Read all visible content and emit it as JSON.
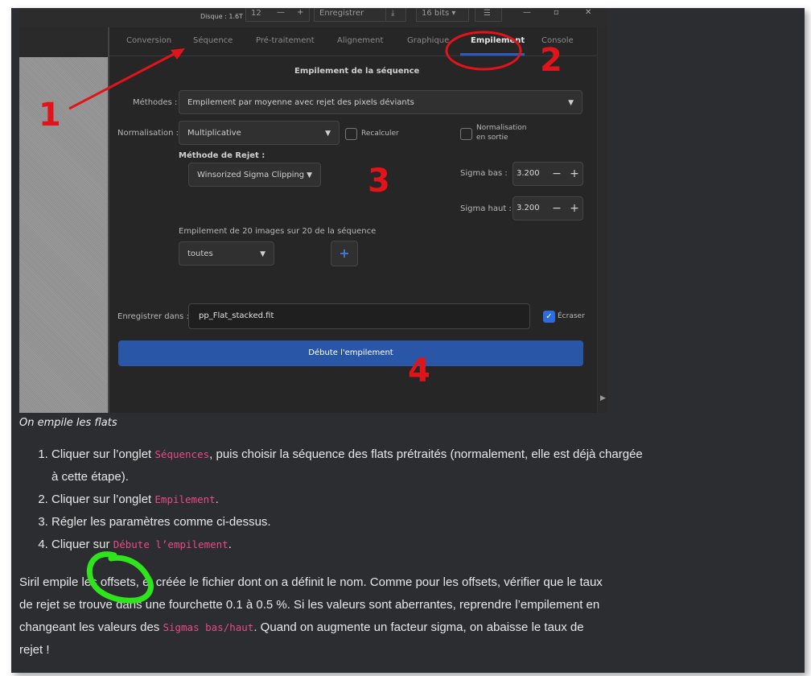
{
  "screenshot": {
    "topbar": {
      "disk_label": "Disque : 1.6T",
      "spin_value": "12",
      "save_label": "Enregistrer",
      "bits_label": "16 bits"
    },
    "tabs": [
      {
        "label": "Conversion"
      },
      {
        "label": "Séquence"
      },
      {
        "label": "Pré-traitement"
      },
      {
        "label": "Alignement"
      },
      {
        "label": "Graphique"
      },
      {
        "label": "Empilement"
      },
      {
        "label": "Console"
      }
    ],
    "active_tab": "Empilement",
    "panel": {
      "title": "Empilement de la séquence",
      "methods_label": "Méthodes :",
      "methods_value": "Empilement par moyenne avec rejet des pixels déviants",
      "normalisation_label": "Normalisation :",
      "normalisation_value": "Multiplicative",
      "recalculer_label": "Recalculer",
      "normalisation_sortie_label_1": "Normalisation",
      "normalisation_sortie_label_2": "en sortie",
      "rejet_label": "Méthode de Rejet :",
      "rejet_value": "Winsorized Sigma Clipping",
      "sigma_bas_label": "Sigma bas :",
      "sigma_bas_value": "3.200",
      "sigma_haut_label": "Sigma haut :",
      "sigma_haut_value": "3.200",
      "stack_count_label": "Empilement de 20 images sur 20 de la séquence",
      "filter_value": "toutes",
      "save_in_label": "Enregistrer dans :",
      "save_in_value": "pp_Flat_stacked.fit",
      "ecraser_label": "Écraser",
      "ecraser_checked": true,
      "start_button": "Débute l'empilement"
    },
    "annotations": {
      "n1": "1",
      "n2": "2",
      "n3": "3",
      "n4": "4",
      "red_color": "#e0141a",
      "green_color": "#2ee51c"
    }
  },
  "caption": "On empile les flats",
  "steps": {
    "s1_prefix": "Cliquer sur l’onglet ",
    "s1_code": "Séquences",
    "s1_suffix": ", puis choisir la séquence des flats prétraités (normalement, elle est déjà chargée à cette étape).",
    "s2_prefix": "Cliquer sur l’onglet ",
    "s2_code": "Empilement",
    "s2_suffix": ".",
    "s3": "Régler les paramètres comme ci-dessus.",
    "s4_prefix": "Cliquer sur ",
    "s4_code": "Débute l’empilement",
    "s4_suffix": "."
  },
  "paragraph": {
    "part1": "Siril empile les offsets, et créée le fichier dont on a définit le nom. Comme pour les offsets, vérifier que le taux de rejet se trouve dans une fourchette 0.1 à 0.5 %. Si les valeurs sont aberrantes, reprendre l’empilement en changeant les valeurs des ",
    "code": "Sigmas bas/haut",
    "part2": ". Quand on augmente un facteur sigma, on abaisse le taux de rejet !"
  }
}
